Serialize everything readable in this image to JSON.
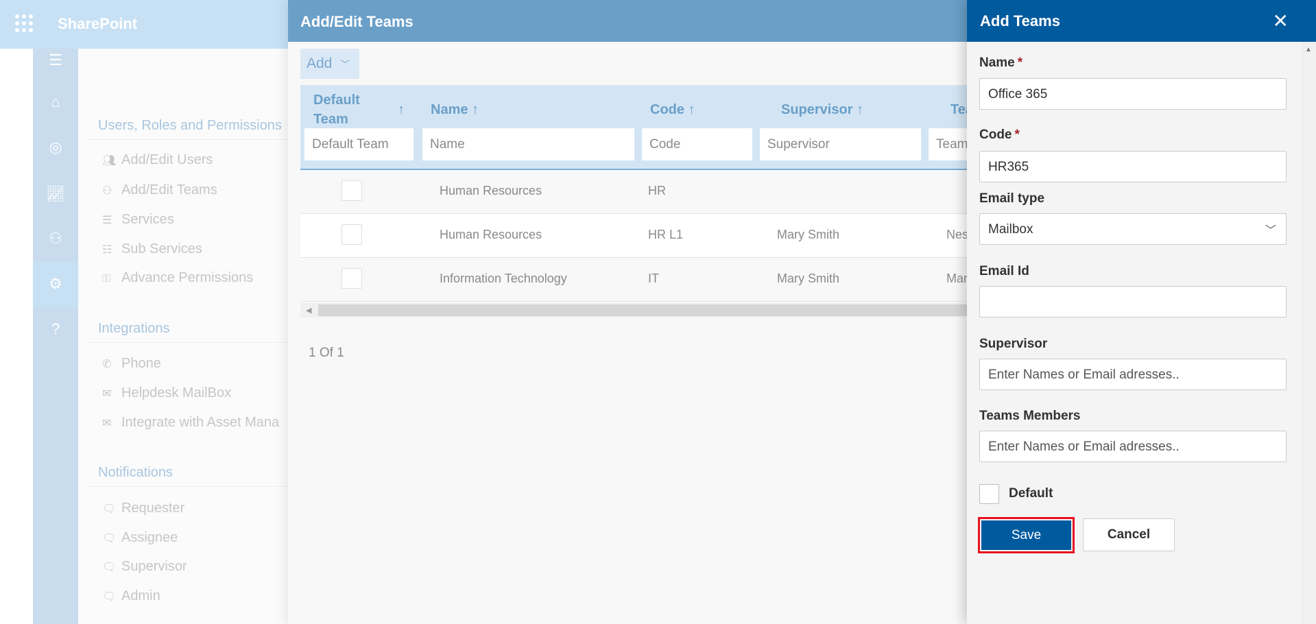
{
  "app": {
    "title": "SharePoint"
  },
  "rail": {
    "items": [
      "menu-icon",
      "home-icon",
      "dashboard-icon",
      "reports-icon",
      "users-assets-icon",
      "settings-icon",
      "help-icon"
    ],
    "selected": "settings-icon"
  },
  "nav": {
    "sections": [
      {
        "heading": "Users, Roles and Permissions",
        "items": [
          "Add/Edit Users",
          "Add/Edit Teams",
          "Services",
          "Sub Services",
          "Advance Permissions"
        ]
      },
      {
        "heading": "Integrations",
        "items": [
          "Phone",
          "Helpdesk MailBox",
          "Integrate with Asset Mana"
        ]
      },
      {
        "heading": "Notifications",
        "items": [
          "Requester",
          "Assignee",
          "Supervisor",
          "Admin"
        ]
      }
    ]
  },
  "teams_panel": {
    "title": "Add/Edit Teams",
    "add_label": "Add",
    "columns": [
      {
        "label": "Default Team",
        "filter": "Default Team"
      },
      {
        "label": "Name ↑",
        "filter": "Name"
      },
      {
        "label": "Code ↑",
        "filter": "Code"
      },
      {
        "label": "Supervisor ↑",
        "filter": "Supervisor"
      },
      {
        "label": "Team",
        "filter": "Team"
      }
    ],
    "sort_arrow": "↑",
    "rows": [
      {
        "name": "Human Resources",
        "code": "HR",
        "supervisor": "",
        "team": ""
      },
      {
        "name": "Human Resources",
        "code": "HR L1",
        "supervisor": "Mary Smith",
        "team": "Nesto"
      },
      {
        "name": "Information Technology",
        "code": "IT",
        "supervisor": "Mary Smith",
        "team": "Mary S"
      }
    ],
    "pager": "1 Of 1"
  },
  "form": {
    "title": "Add Teams",
    "required_mark": "*",
    "name_label": "Name",
    "name_value": "Office 365",
    "code_label": "Code",
    "code_value": "HR365",
    "email_type_label": "Email type",
    "email_type_value": "Mailbox",
    "email_id_label": "Email Id",
    "email_id_value": "",
    "supervisor_label": "Supervisor",
    "supervisor_placeholder": "Enter Names or Email adresses..",
    "members_label": "Teams Members",
    "members_placeholder": "Enter Names or Email adresses..",
    "default_label": "Default",
    "default_checked": false,
    "save_label": "Save",
    "cancel_label": "Cancel"
  },
  "colors": {
    "primary": "#005a9e",
    "panel_header": "#6a9fc8",
    "topbar": "#c7e0f4",
    "highlight": "#e81123",
    "required": "#a4262c"
  }
}
